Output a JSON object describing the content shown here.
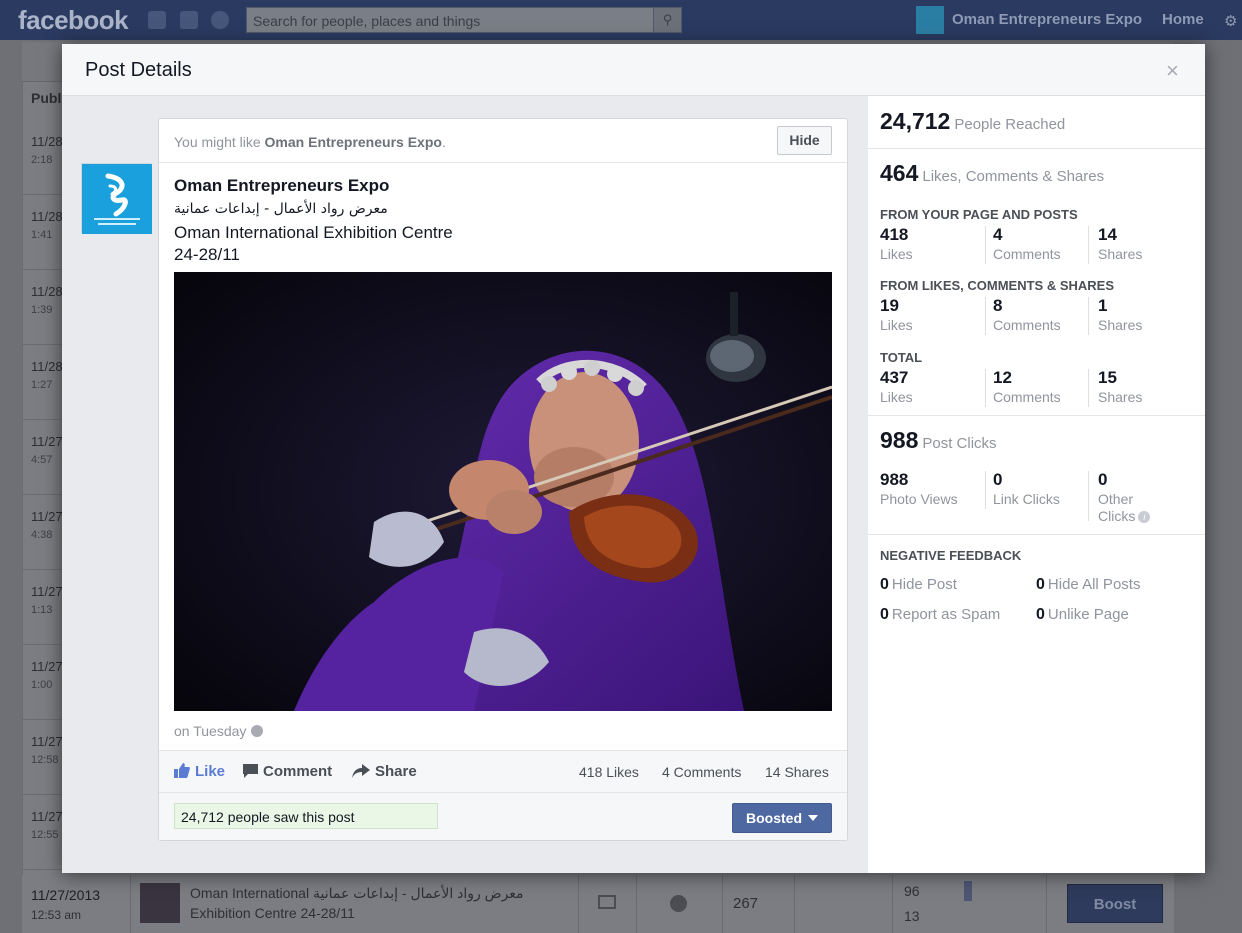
{
  "topbar": {
    "logo": "facebook",
    "search_placeholder": "Search for people, places and things",
    "page_name": "Oman Entrepreneurs Expo",
    "home": "Home"
  },
  "background_table": {
    "column_header": "Publ",
    "rows": [
      {
        "date": "11/28",
        "time": "2:18"
      },
      {
        "date": "11/28",
        "time": "1:41"
      },
      {
        "date": "11/28",
        "time": "1:39"
      },
      {
        "date": "11/28",
        "time": "1:27"
      },
      {
        "date": "11/27",
        "time": "4:57"
      },
      {
        "date": "11/27",
        "time": "4:38"
      },
      {
        "date": "11/27",
        "time": "1:13"
      },
      {
        "date": "11/27",
        "time": "1:00"
      },
      {
        "date": "11/27",
        "time": "12:58"
      },
      {
        "date": "11/27",
        "time": "12:55"
      }
    ],
    "bottom_row": {
      "date": "11/27/2013",
      "time": "12:53 am",
      "title_line1": "Oman International معرض رواد الأعمال - إبداعات عمانية",
      "title_line2": "Exhibition Centre 24-28/11",
      "reach": "267",
      "stat1": "96",
      "stat2": "13",
      "boost_label": "Boost"
    }
  },
  "modal": {
    "title": "Post Details",
    "close": "×"
  },
  "post": {
    "suggest_prefix": "You might like ",
    "suggest_page": "Oman Entrepreneurs Expo",
    "suggest_suffix": ".",
    "hide_label": "Hide",
    "page_name": "Oman Entrepreneurs Expo",
    "arabic_line": "معرض رواد الأعمال - إبداعات عمانية",
    "venue_line": "Oman International Exhibition Centre",
    "date_line": "24-28/11",
    "posted": "on Tuesday",
    "actions": {
      "like": "Like",
      "comment": "Comment",
      "share": "Share"
    },
    "counts": {
      "likes": "418 Likes",
      "comments": "4 Comments",
      "shares": "14 Shares"
    },
    "reach_text": "24,712 people saw this post",
    "boosted_label": "Boosted"
  },
  "insights": {
    "reached": {
      "value": "24,712",
      "label": "People Reached"
    },
    "engagement": {
      "value": "464",
      "label": "Likes, Comments & Shares"
    },
    "from_page": {
      "heading": "FROM YOUR PAGE AND POSTS",
      "likes": "418",
      "comments": "4",
      "shares": "14"
    },
    "from_lcs": {
      "heading": "FROM LIKES, COMMENTS & SHARES",
      "likes": "19",
      "comments": "8",
      "shares": "1"
    },
    "total": {
      "heading": "TOTAL",
      "likes": "437",
      "comments": "12",
      "shares": "15"
    },
    "labels": {
      "likes": "Likes",
      "comments": "Comments",
      "shares": "Shares"
    },
    "post_clicks": {
      "value": "988",
      "label": "Post Clicks"
    },
    "clicks": {
      "photo_views": "988",
      "photo_views_label": "Photo Views",
      "link_clicks": "0",
      "link_clicks_label": "Link Clicks",
      "other_clicks": "0",
      "other_label_1": "Other",
      "other_label_2": "Clicks"
    },
    "negative": {
      "heading": "NEGATIVE FEEDBACK",
      "hide_post": {
        "value": "0",
        "label": "Hide Post"
      },
      "hide_all": {
        "value": "0",
        "label": "Hide All Posts"
      },
      "spam": {
        "value": "0",
        "label": "Report as Spam"
      },
      "unlike": {
        "value": "0",
        "label": "Unlike Page"
      }
    }
  },
  "colors": {
    "modal_bg": "#e9eaed",
    "accent": "#4e69a2",
    "like_blue": "#5b7bd5",
    "reach_green": "#eaf7e6"
  }
}
